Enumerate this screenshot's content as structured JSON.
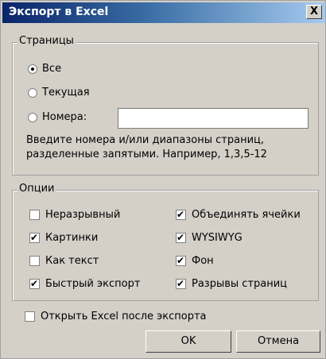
{
  "window": {
    "title": "Экспорт в Excel",
    "close_label": "X"
  },
  "pages_group": {
    "title": "Страницы",
    "radio_all": "Все",
    "radio_current": "Текущая",
    "radio_numbers": "Номера:",
    "selected": "all",
    "numbers_input_value": "",
    "hint": "Введите номера и/или диапазоны страниц, разделенные запятыми. Например, 1,3,5-12"
  },
  "options_group": {
    "title": "Опции",
    "items": [
      {
        "label": "Неразрывный",
        "checked": false
      },
      {
        "label": "Объединять ячейки",
        "checked": true
      },
      {
        "label": "Картинки",
        "checked": true
      },
      {
        "label": "WYSIWYG",
        "checked": true
      },
      {
        "label": "Как текст",
        "checked": false
      },
      {
        "label": "Фон",
        "checked": true
      },
      {
        "label": "Быстрый экспорт",
        "checked": true
      },
      {
        "label": "Разрывы страниц",
        "checked": true
      }
    ]
  },
  "open_excel": {
    "label": "Открыть Excel после экспорта",
    "checked": false
  },
  "buttons": {
    "ok": "OK",
    "cancel": "Отмена"
  }
}
